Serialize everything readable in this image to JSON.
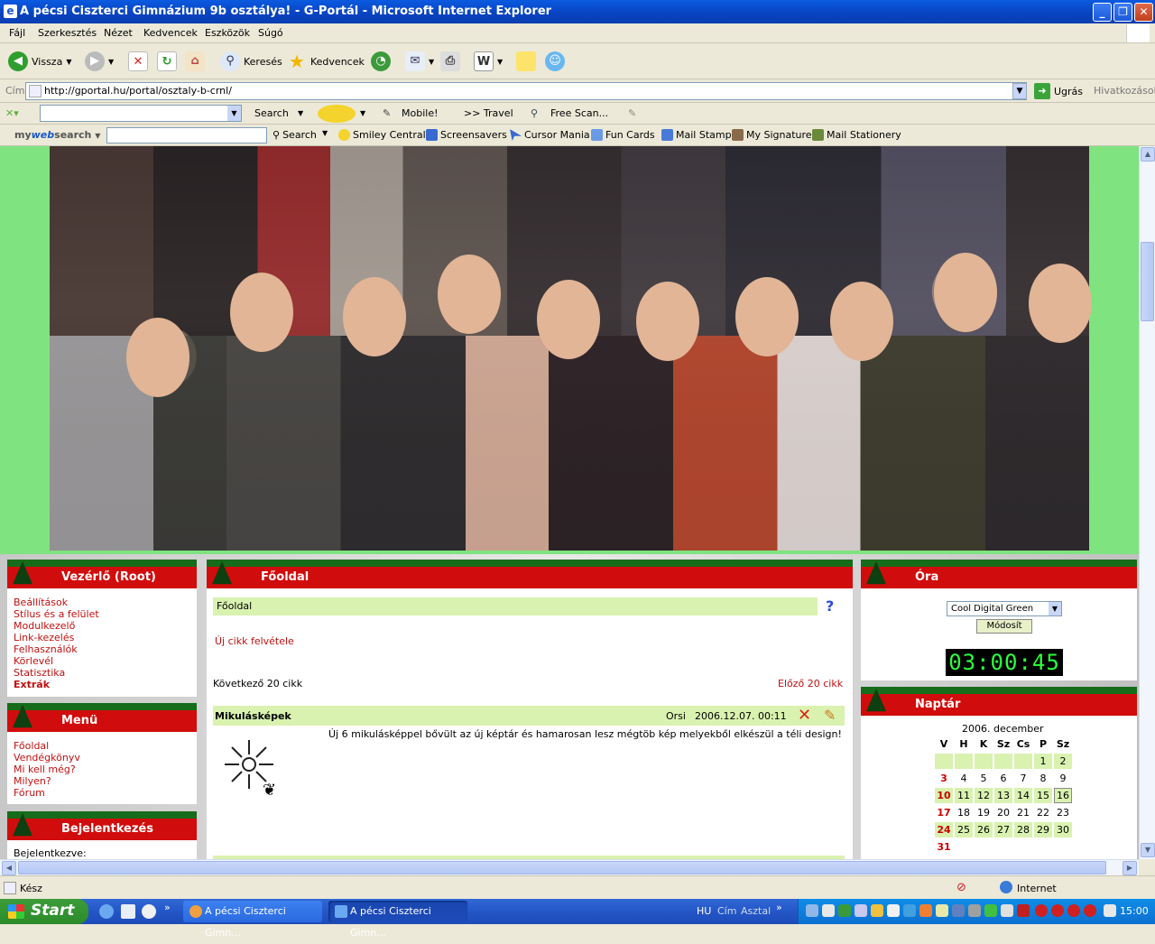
{
  "window": {
    "title": "A pécsi Ciszterci Gimnázium 9b osztálya! - G-Portál - Microsoft Internet Explorer",
    "buttons": [
      "_",
      "❐",
      "✕"
    ]
  },
  "menu": [
    "Fájl",
    "Szerkesztés",
    "Nézet",
    "Kedvencek",
    "Eszközök",
    "Súgó"
  ],
  "toolbar": {
    "back": "Vissza",
    "search": "Keresés",
    "favorites": "Kedvencek"
  },
  "address": {
    "label": "Cím",
    "url": "http://gportal.hu/portal/osztaly-b-crnl/",
    "go": "Ugrás",
    "links": "Hivatkozások"
  },
  "search_toolbar": {
    "search": "Search",
    "mobile": "Mobile!",
    "travel": ">> Travel",
    "freescan": "Free Scan..."
  },
  "mws_toolbar": {
    "brand_a": "my",
    "brand_b": "web",
    "brand_c": "search",
    "search": "Search",
    "items": [
      "Smiley Central",
      "Screensavers",
      "Cursor Mania",
      "Fun Cards",
      "Mail Stamp",
      "My Signature",
      "Mail Stationery"
    ]
  },
  "vezerlo": {
    "title": "Vezérlő (Root)",
    "items": [
      "Beállítások",
      "Stílus és a felület",
      "Modulkezelő",
      "Link-kezelés",
      "Felhasználók",
      "Körlevél",
      "Statisztika",
      "Extrák"
    ]
  },
  "menu_panel": {
    "title": "Menü",
    "items": [
      "Főoldal",
      "Vendégkönyv",
      "Mi kell még?",
      "Milyen?",
      "Fórum"
    ]
  },
  "login": {
    "title": "Bejelentkezés",
    "text": "Bejelentkezve:"
  },
  "main": {
    "title": "Főoldal",
    "breadcrumb": "Főoldal",
    "help": "?",
    "new_article": "Új cikk felvétele",
    "next": "Következő 20 cikk",
    "prev": "Előző 20 cikk",
    "article": {
      "title": "Mikulásképek",
      "author": "Orsi",
      "date": "2006.12.07. 00:11",
      "body": "Új 6 mikulásképpel bővült az új képtár és hamarosan lesz mégtöb kép melyekből elkészül a téli design!"
    }
  },
  "clock": {
    "title": "Óra",
    "select": "Cool Digital Green",
    "button": "Módosít",
    "time": "03:00:45"
  },
  "calendar": {
    "title": "Naptár",
    "month": "2006. december",
    "headers": [
      "V",
      "H",
      "K",
      "Sz",
      "Cs",
      "P",
      "Sz"
    ],
    "rows": [
      [
        "",
        "",
        "",
        "",
        "",
        "1",
        "2"
      ],
      [
        "3",
        "4",
        "5",
        "6",
        "7",
        "8",
        "9"
      ],
      [
        "10",
        "11",
        "12",
        "13",
        "14",
        "15",
        "16"
      ],
      [
        "17",
        "18",
        "19",
        "20",
        "21",
        "22",
        "23"
      ],
      [
        "24",
        "25",
        "26",
        "27",
        "28",
        "29",
        "30"
      ],
      [
        "31",
        "",
        "",
        "",
        "",
        "",
        ""
      ]
    ]
  },
  "status": {
    "text": "Kész",
    "zone": "Internet"
  },
  "taskbar": {
    "start": "Start",
    "tasks": [
      "A pécsi Ciszterci Gimn...",
      "A pécsi Ciszterci Gimn..."
    ],
    "lang": "HU",
    "cim": "Cím",
    "asztal": "Asztal",
    "time": "15:00"
  }
}
